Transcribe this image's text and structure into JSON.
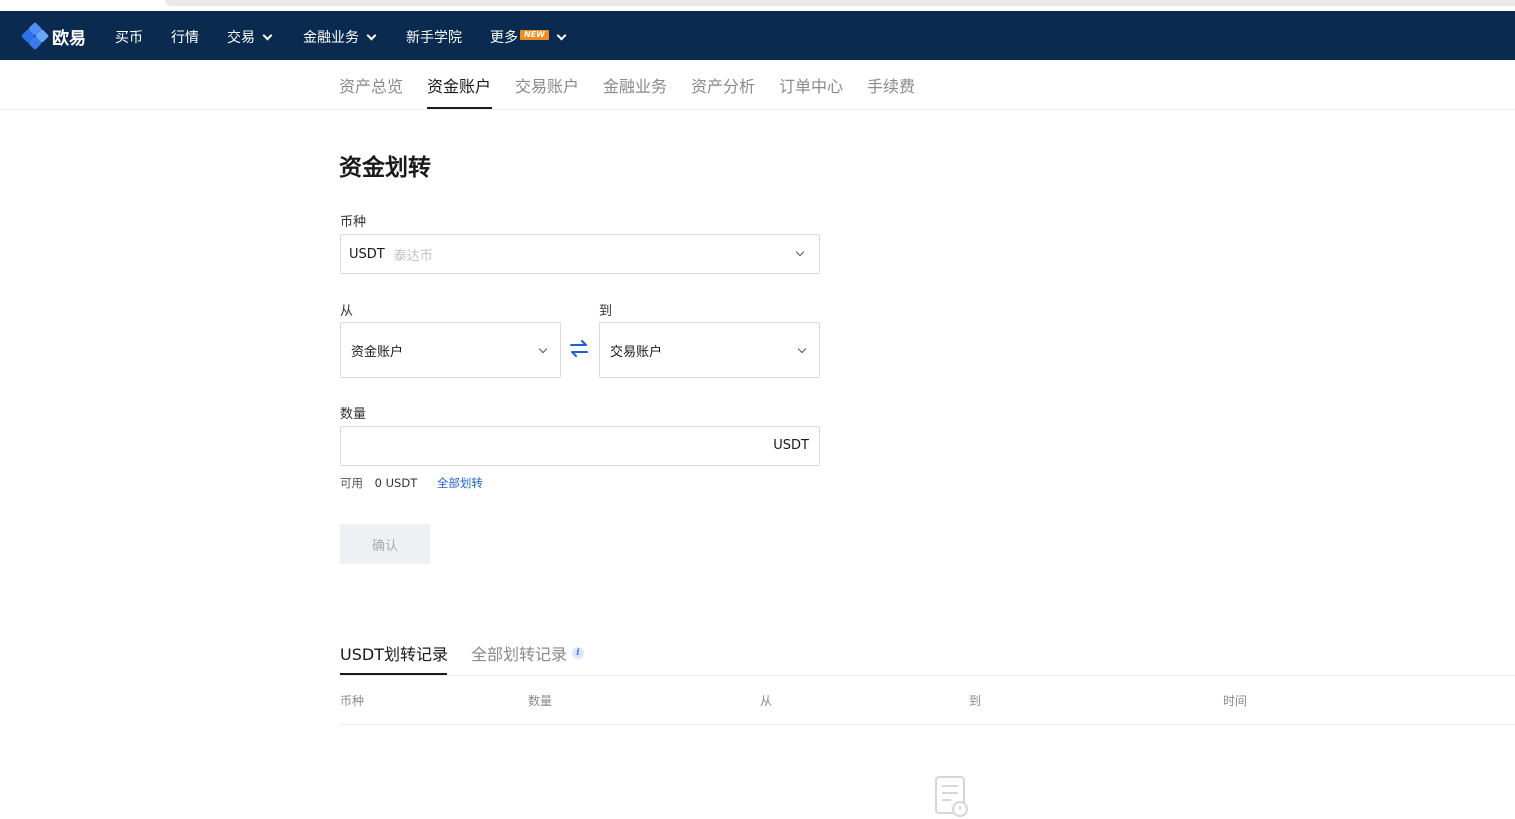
{
  "nav": {
    "brand": "欧易",
    "items": [
      {
        "label": "买币",
        "dropdown": false
      },
      {
        "label": "行情",
        "dropdown": false
      },
      {
        "label": "交易",
        "dropdown": true
      },
      {
        "label": "金融业务",
        "dropdown": true
      },
      {
        "label": "新手学院",
        "dropdown": false
      },
      {
        "label": "更多",
        "dropdown": true,
        "badge": "NEW"
      }
    ]
  },
  "subtabs": {
    "items": [
      "资产总览",
      "资金账户",
      "交易账户",
      "金融业务",
      "资产分析",
      "订单中心",
      "手续费"
    ],
    "active": "资金账户"
  },
  "transfer": {
    "title": "资金划转",
    "currency_label": "币种",
    "currency_value": "USDT",
    "currency_name": "泰达币",
    "from_label": "从",
    "from_value": "资金账户",
    "to_label": "到",
    "to_value": "交易账户",
    "amount_label": "数量",
    "amount_value": "",
    "amount_unit": "USDT",
    "available_label": "可用",
    "available_value": "0 USDT",
    "transfer_all": "全部划转",
    "confirm": "确认"
  },
  "records": {
    "tabs": [
      "USDT划转记录",
      "全部划转记录"
    ],
    "active_tab": "USDT划转记录",
    "columns": [
      "币种",
      "数量",
      "从",
      "到",
      "时间"
    ]
  },
  "colors": {
    "nav_bg": "#0b2a4f",
    "accent": "#1f5fd6",
    "badge": "#f28c1a"
  }
}
